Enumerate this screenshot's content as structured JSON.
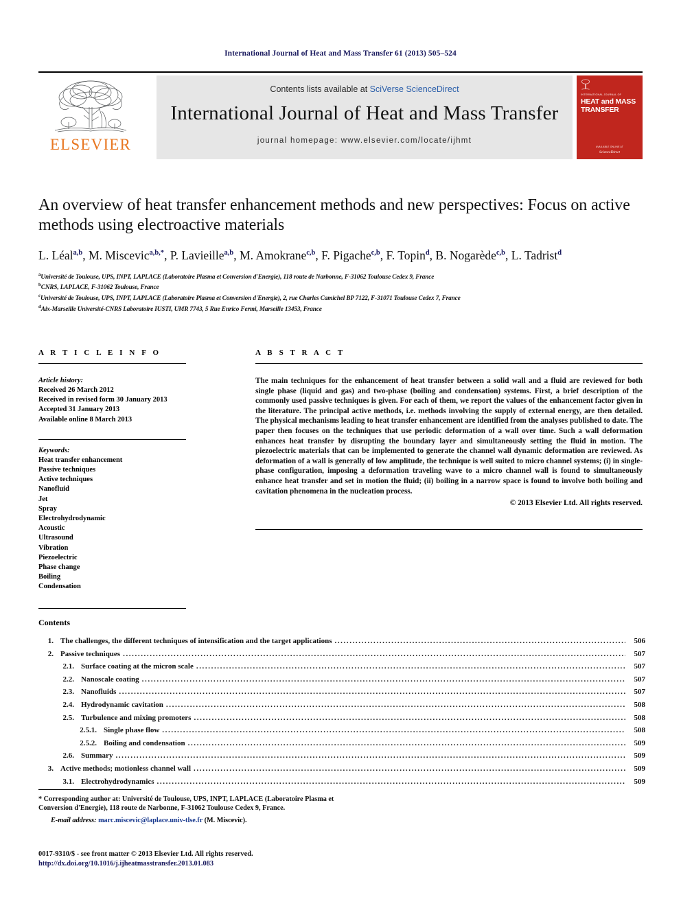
{
  "running_head": "International Journal of Heat and Mass Transfer 61 (2013) 505–524",
  "masthead": {
    "contents_prefix": "Contents lists available at ",
    "sciencedirect": "SciVerse ScienceDirect",
    "journal_title": "International Journal of Heat and Mass Transfer",
    "homepage": "journal homepage: www.elsevier.com/locate/ijhmt",
    "publisher": "ELSEVIER",
    "cover": {
      "subtitle": "INTERNATIONAL JOURNAL OF",
      "title_line1": "HEAT and MASS",
      "title_line2": "TRANSFER",
      "and_word": "and",
      "footer1": "AVAILABLE ONLINE AT",
      "footer2": "ScienceDirect"
    },
    "colors": {
      "elsevier_orange": "#E87722",
      "cover_red": "#c0261e",
      "panel_gray": "#e6e6e6",
      "link_blue": "#2b5faa"
    }
  },
  "article": {
    "title": "An overview of heat transfer enhancement methods and new perspectives: Focus on active methods using electroactive materials",
    "authors": [
      {
        "name": "L. Léal",
        "sup": "a,b",
        "sep": ", "
      },
      {
        "name": "M. Miscevic",
        "sup": "a,b,*",
        "sep": ", "
      },
      {
        "name": "P. Lavieille",
        "sup": "a,b",
        "sep": ", "
      },
      {
        "name": "M. Amokrane",
        "sup": "c,b",
        "sep": ", "
      },
      {
        "name": "F. Pigache",
        "sup": "c,b",
        "sep": ", "
      },
      {
        "name": "F. Topin",
        "sup": "d",
        "sep": ", "
      },
      {
        "name": "B. Nogarède",
        "sup": "c,b",
        "sep": ", "
      },
      {
        "name": "L. Tadrist",
        "sup": "d",
        "sep": ""
      }
    ],
    "affiliations": [
      {
        "mark": "a",
        "text": "Université de Toulouse, UPS, INPT, LAPLACE (Laboratoire Plasma et Conversion d'Energie), 118 route de Narbonne, F-31062 Toulouse Cedex 9, France"
      },
      {
        "mark": "b",
        "text": "CNRS, LAPLACE, F-31062 Toulouse, France"
      },
      {
        "mark": "c",
        "text": "Université de Toulouse, UPS, INPT, LAPLACE (Laboratoire Plasma et Conversion d'Energie), 2, rue Charles Camichel BP 7122, F-31071 Toulouse Cedex 7, France"
      },
      {
        "mark": "d",
        "text": "Aix-Marseille Université-CNRS Laboratoire IUSTI, UMR 7743, 5 Rue Enrico Fermi, Marseille 13453, France"
      }
    ]
  },
  "article_info": {
    "heading": "A R T I C L E   I N F O",
    "history_label": "Article history:",
    "history": [
      "Received 26 March 2012",
      "Received in revised form 30 January 2013",
      "Accepted 31 January 2013",
      "Available online 8 March 2013"
    ],
    "keywords_label": "Keywords:",
    "keywords": [
      "Heat transfer enhancement",
      "Passive techniques",
      "Active techniques",
      "Nanofluid",
      "Jet",
      "Spray",
      "Electrohydrodynamic",
      "Acoustic",
      "Ultrasound",
      "Vibration",
      "Piezoelectric",
      "Phase change",
      "Boiling",
      "Condensation"
    ]
  },
  "abstract": {
    "heading": "A B S T R A C T",
    "text": "The main techniques for the enhancement of heat transfer between a solid wall and a fluid are reviewed for both single phase (liquid and gas) and two-phase (boiling and condensation) systems. First, a brief description of the commonly used passive techniques is given. For each of them, we report the values of the enhancement factor given in the literature. The principal active methods, i.e. methods involving the supply of external energy, are then detailed. The physical mechanisms leading to heat transfer enhancement are identified from the analyses published to date. The paper then focuses on the techniques that use periodic deformation of a wall over time. Such a wall deformation enhances heat transfer by disrupting the boundary layer and simultaneously setting the fluid in motion. The piezoelectric materials that can be implemented to generate the channel wall dynamic deformation are reviewed. As deformation of a wall is generally of low amplitude, the technique is well suited to micro channel systems; (i) in single-phase configuration, imposing a deformation traveling wave to a micro channel wall is found to simultaneously enhance heat transfer and set in motion the fluid; (ii) boiling in a narrow space is found to involve both boiling and cavitation phenomena in the nucleation process.",
    "copyright": "© 2013 Elsevier Ltd. All rights reserved."
  },
  "contents": {
    "heading": "Contents",
    "entries": [
      {
        "level": 1,
        "num": "1.",
        "text": "The challenges, the different techniques of intensification and the target applications",
        "page": "506"
      },
      {
        "level": 1,
        "num": "2.",
        "text": "Passive techniques",
        "page": "507"
      },
      {
        "level": 2,
        "num": "2.1.",
        "text": "Surface coating at the micron scale",
        "page": "507"
      },
      {
        "level": 2,
        "num": "2.2.",
        "text": "Nanoscale coating",
        "page": "507"
      },
      {
        "level": 2,
        "num": "2.3.",
        "text": "Nanofluids",
        "page": "507"
      },
      {
        "level": 2,
        "num": "2.4.",
        "text": "Hydrodynamic cavitation",
        "page": "508"
      },
      {
        "level": 2,
        "num": "2.5.",
        "text": "Turbulence and mixing promoters",
        "page": "508"
      },
      {
        "level": 3,
        "num": "2.5.1.",
        "text": "Single phase flow",
        "page": "508"
      },
      {
        "level": 3,
        "num": "2.5.2.",
        "text": "Boiling and condensation",
        "page": "509"
      },
      {
        "level": 2,
        "num": "2.6.",
        "text": "Summary",
        "page": "509"
      },
      {
        "level": 1,
        "num": "3.",
        "text": "Active methods; motionless channel wall",
        "page": "509"
      },
      {
        "level": 2,
        "num": "3.1.",
        "text": "Electrohydrodynamics",
        "page": "509"
      }
    ]
  },
  "footnotes": {
    "corresponding": "* Corresponding author at: Université de Toulouse, UPS, INPT, LAPLACE (Laboratoire Plasma et Conversion d'Energie), 118 route de Narbonne, F-31062 Toulouse Cedex 9, France.",
    "email_label": "E-mail address:",
    "email": "marc.miscevic@laplace.univ-tlse.fr",
    "email_owner": "(M. Miscevic).",
    "issn": "0017-9310/$ - see front matter © 2013 Elsevier Ltd. All rights reserved.",
    "doi": "http://dx.doi.org/10.1016/j.ijheatmasstransfer.2013.01.083"
  }
}
